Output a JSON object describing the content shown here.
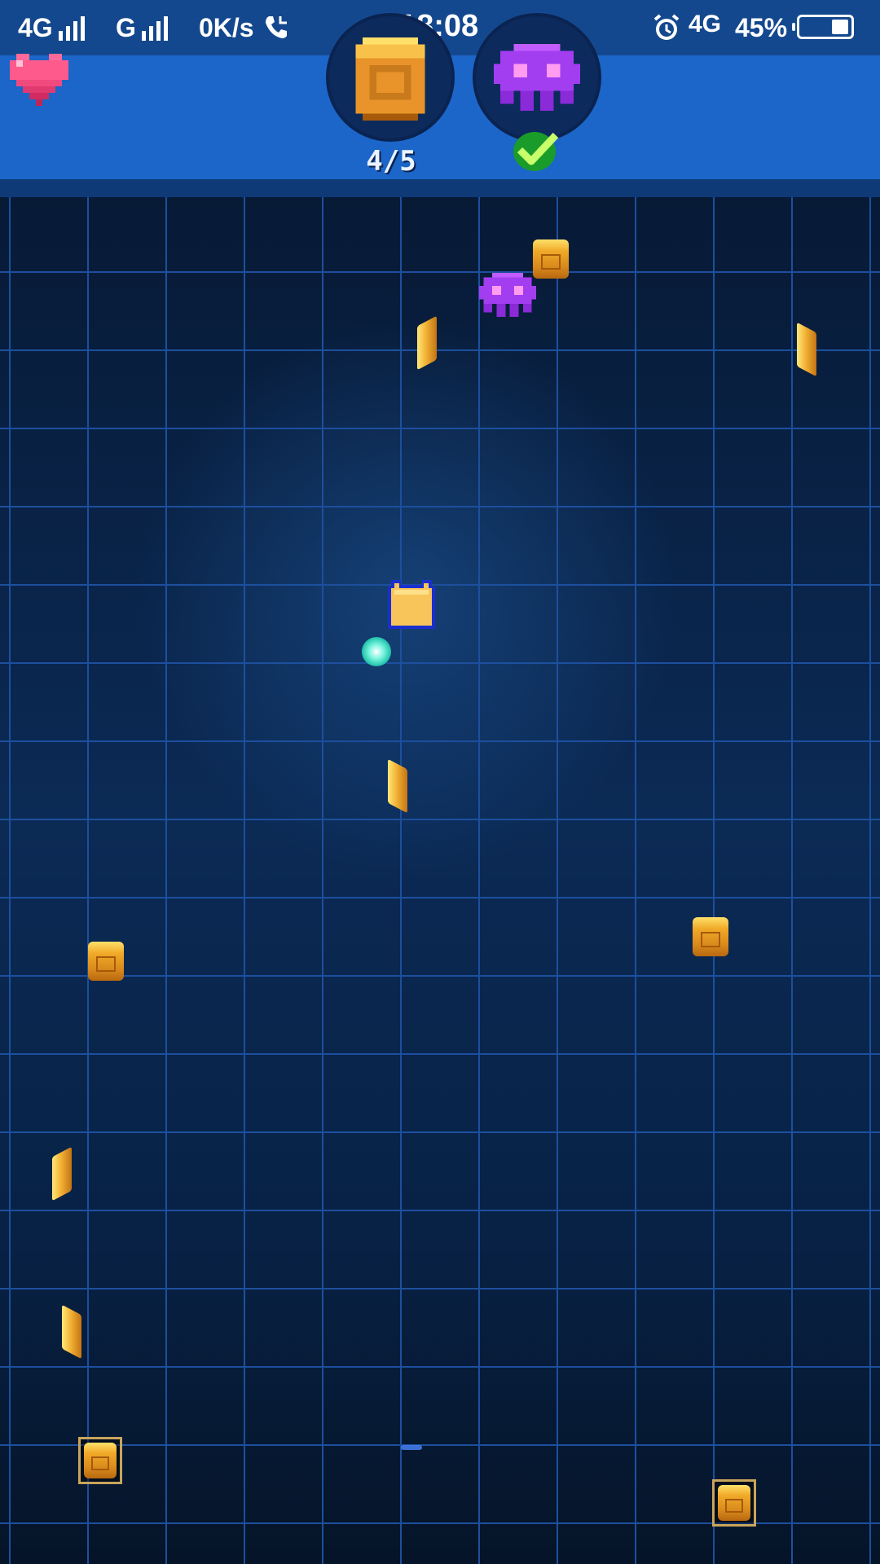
{
  "status_bar": {
    "network_1": "4G",
    "network_2": "G",
    "speed": "0K/s",
    "time": "18:08",
    "network_3": "4G",
    "battery": "45%"
  },
  "hud": {
    "lives_icon": "heart-icon",
    "goal_coin_icon": "coin-icon",
    "goal_counter": "4/5",
    "goal_enemy_icon": "purple-ghost-icon",
    "goal_enemy_status_icon": "checkmark-icon"
  },
  "colors": {
    "status_bar_bg": "#14488e",
    "hud_bg": "#1b66c8",
    "grid_line": "#1d4f9e",
    "coin": "#f0a928",
    "enemy": "#a33ef0",
    "player": "#f7c55a",
    "checkmark": "#22b832"
  }
}
